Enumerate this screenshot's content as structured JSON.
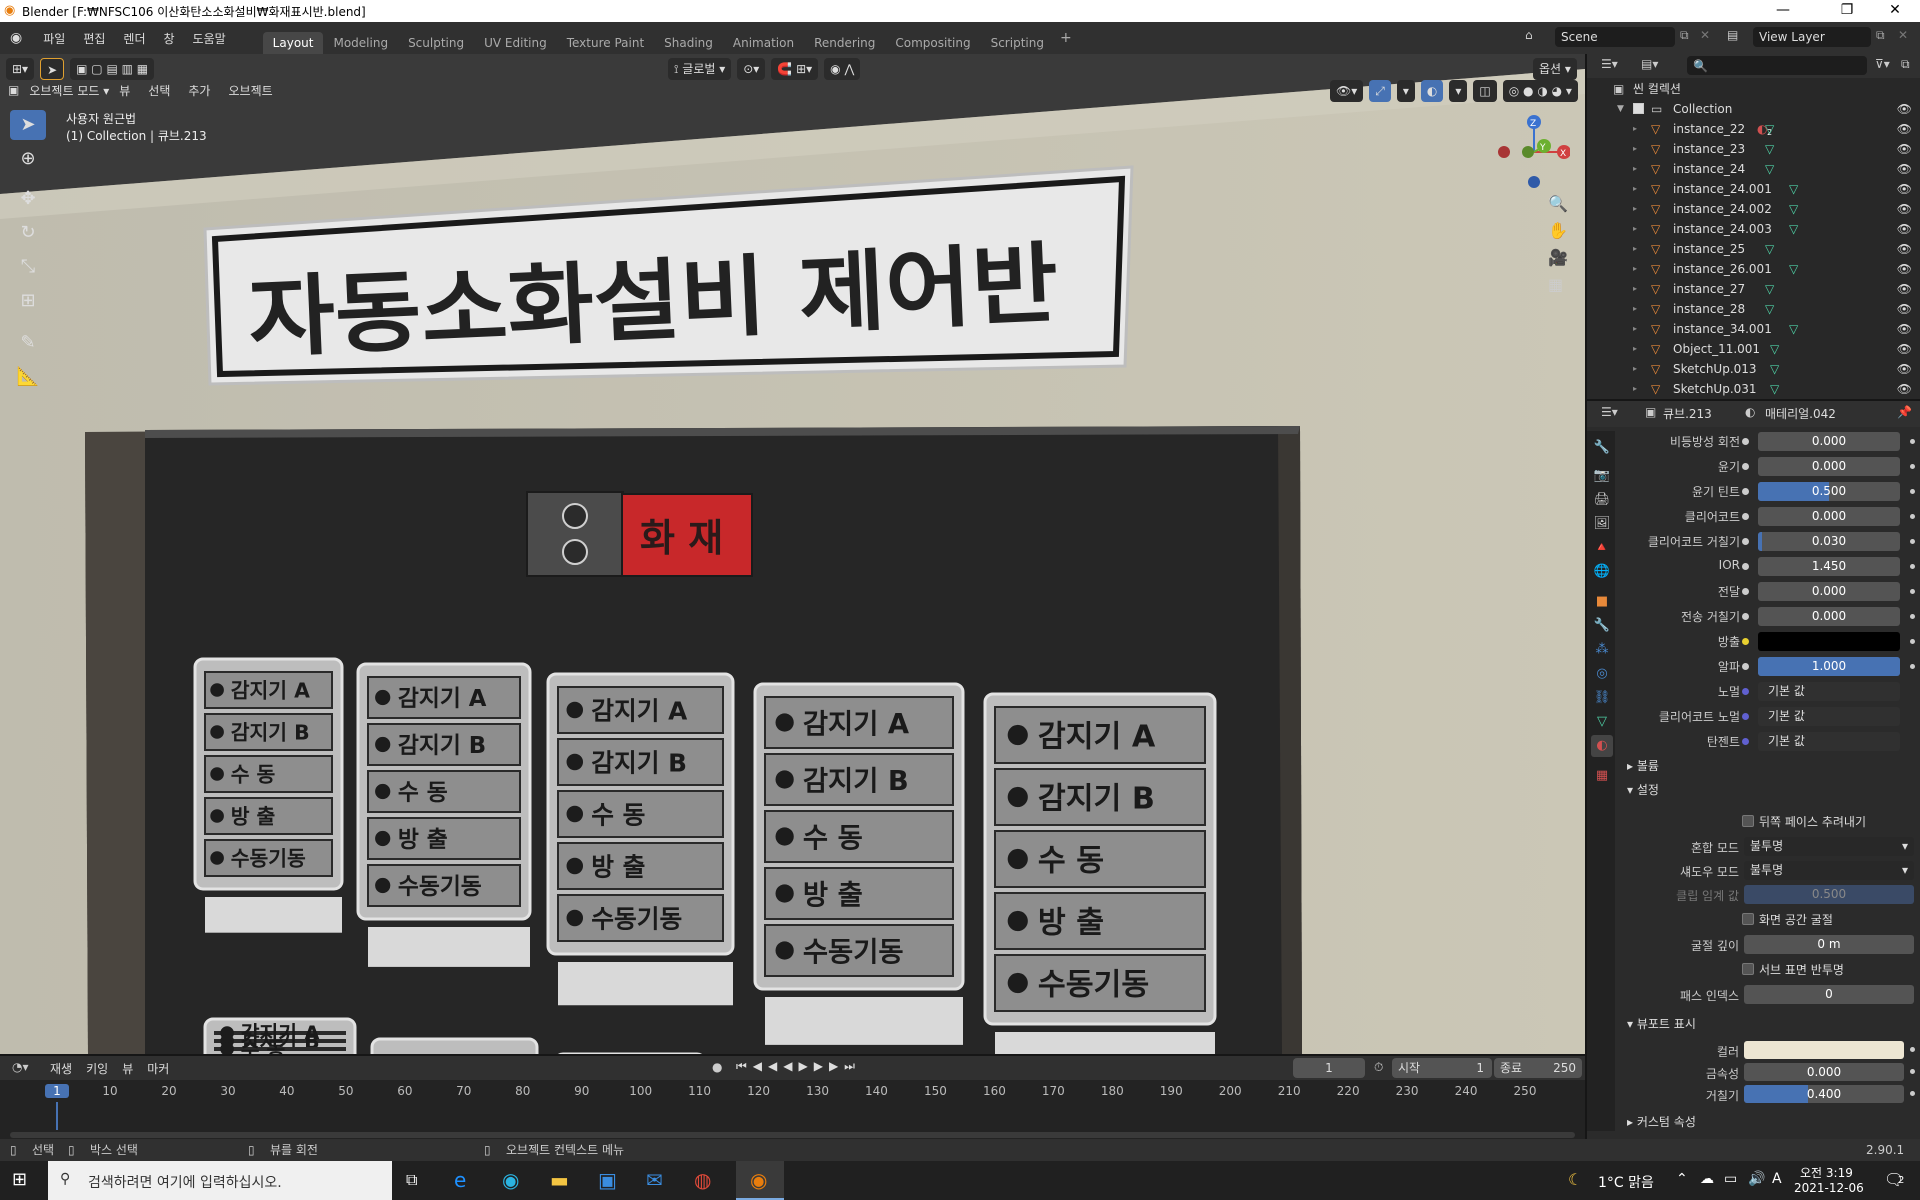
{
  "window": {
    "title": "Blender [F:₩NFSC106 이산화탄소소화설비₩화재표시반.blend]"
  },
  "menu": [
    "파일",
    "편집",
    "렌더",
    "창",
    "도움말"
  ],
  "workspaces": [
    "Layout",
    "Modeling",
    "Sculpting",
    "UV Editing",
    "Texture Paint",
    "Shading",
    "Animation",
    "Rendering",
    "Compositing",
    "Scripting"
  ],
  "scene": {
    "name": "Scene",
    "view_layer": "View Layer"
  },
  "viewport_header": {
    "orientation": "글로벌",
    "options": "옵션",
    "mode": "오브젝트 모드",
    "menus": [
      "뷰",
      "선택",
      "추가",
      "오브젝트"
    ]
  },
  "viewport_info": {
    "projection": "사용자 원근법",
    "context": "(1) Collection | 큐브.213"
  },
  "scene3d": {
    "sign_text": "자동소화설비 제어반",
    "alarm_text": "화 재",
    "label_lines": [
      "감지기 A",
      "감지기 B",
      "수 동",
      "방 출",
      "수동기동"
    ]
  },
  "outliner": {
    "scene_collection": "씬 컬렉션",
    "collection": "Collection",
    "items": [
      "instance_22",
      "instance_23",
      "instance_24",
      "instance_24.001",
      "instance_24.002",
      "instance_24.003",
      "instance_25",
      "instance_26.001",
      "instance_27",
      "instance_28",
      "instance_34.001",
      "Object_11.001",
      "SketchUp.013",
      "SketchUp.031"
    ],
    "badge": "2"
  },
  "properties": {
    "object": "큐브.213",
    "material": "매테리얼.042",
    "rows": [
      {
        "label": "비등방성 회전",
        "value": "0.000",
        "fill": 0
      },
      {
        "label": "윤기",
        "value": "0.000",
        "fill": 0
      },
      {
        "label": "윤기 틴트",
        "value": "0.500",
        "fill": 0.5
      },
      {
        "label": "클리어코트",
        "value": "0.000",
        "fill": 0
      },
      {
        "label": "클리어코트 거칠기",
        "value": "0.030",
        "fill": 0.03
      },
      {
        "label": "IOR",
        "value": "1.450",
        "fill": 0
      },
      {
        "label": "전달",
        "value": "0.000",
        "fill": 0
      },
      {
        "label": "전송 거칠기",
        "value": "0.000",
        "fill": 0
      },
      {
        "label": "방출",
        "value": "",
        "fill": 0
      },
      {
        "label": "알파",
        "value": "1.000",
        "fill": 1
      },
      {
        "label": "노멀",
        "value": "기본 값",
        "fill": 0
      },
      {
        "label": "클리어코트 노멀",
        "value": "기본 값",
        "fill": 0
      },
      {
        "label": "탄젠트",
        "value": "기본 값",
        "fill": 0
      }
    ],
    "sections": {
      "volume": "볼륨",
      "settings": "설정",
      "viewport": "뷰포트 표시",
      "custom": "커스텀 속성"
    },
    "settings": {
      "backface": "뒤쪽 페이스 추려내기",
      "blend_label": "혼합 모드",
      "blend": "불투명",
      "shadow_label": "섀도우 모드",
      "shadow": "불투명",
      "clip_label": "클립 임계 값",
      "clip": "0.500",
      "ssr": "화면 공간 굴절",
      "refr_label": "굴절 깊이",
      "refr": "0 m",
      "sss": "서브 표면 반투명",
      "pass_label": "패스 인덱스",
      "pass": "0"
    },
    "viewport_display": {
      "color_label": "컬러",
      "color": "#ede6d2",
      "metal_label": "금속성",
      "metal": "0.000",
      "rough_label": "거칠기",
      "rough": "0.400",
      "rough_fill": 0.4
    }
  },
  "timeline": {
    "menus": [
      "재생",
      "키잉",
      "뷰",
      "마커"
    ],
    "current": "1",
    "start_label": "시작",
    "start": "1",
    "end_label": "종료",
    "end": "250",
    "ticks": [
      "1",
      "10",
      "20",
      "30",
      "40",
      "50",
      "60",
      "70",
      "80",
      "90",
      "100",
      "110",
      "120",
      "130",
      "140",
      "150",
      "160",
      "170",
      "180",
      "190",
      "200",
      "210",
      "220",
      "230",
      "240",
      "250"
    ]
  },
  "status": {
    "select": "선택",
    "box": "박스 선택",
    "rotate": "뷰를 회전",
    "context": "오브젝트 컨텍스트 메뉴",
    "version": "2.90.1"
  },
  "taskbar": {
    "search": "검색하려면 여기에 입력하십시오.",
    "weather": "1°C 맑음",
    "time": "오전 3:19",
    "date": "2021-12-06",
    "notif": "2",
    "ime": "A"
  }
}
